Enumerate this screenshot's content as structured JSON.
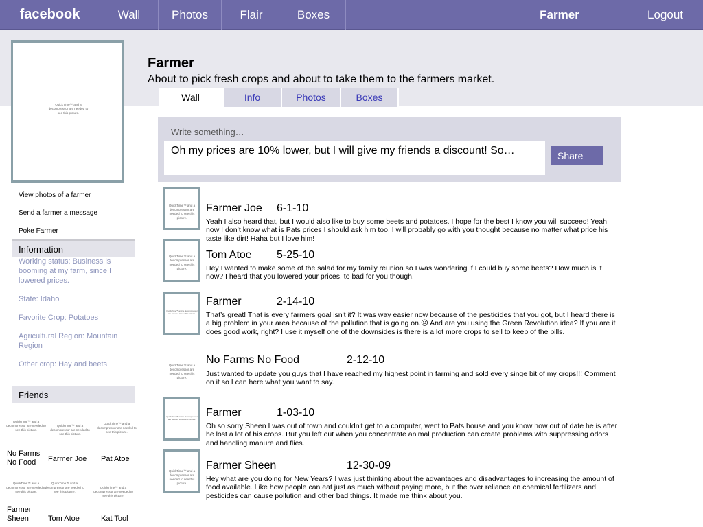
{
  "topnav": {
    "logo": "facebook",
    "links": [
      "Wall",
      "Photos",
      "Flair",
      "Boxes"
    ],
    "user": "Farmer",
    "logout": "Logout"
  },
  "profile": {
    "name": "Farmer",
    "status": "About to pick fresh crops and about to take them to the farmers market.",
    "picture_placeholder": "QuickTime™ and a decompressor are needed to see this picture."
  },
  "tabs": [
    "Wall",
    "Info",
    "Photos",
    "Boxes"
  ],
  "left_links": [
    "View photos of a farmer",
    "Send a farmer a message",
    "Poke Farmer"
  ],
  "information": {
    "header": "Information",
    "items": [
      "Working status:  Business is booming  at my farm, since I lowered prices.",
      "State: Idaho",
      "Favorite Crop: Potatoes",
      "Agricultural Region: Mountain Region",
      "Other crop: Hay and beets"
    ]
  },
  "friends": {
    "header": "Friends",
    "list": [
      {
        "name": "No Farms No Food",
        "thumb": "QuickTime™ and a decompressor are needed to see this picture."
      },
      {
        "name": "Farmer Joe",
        "thumb": "QuickTime™ and a decompressor are needed to see this picture."
      },
      {
        "name": "Pat Atoe",
        "thumb": "QuickTime™ and a decompressor are needed to see this picture."
      },
      {
        "name": "Farmer Sheen",
        "thumb": "QuickTime™ and a decompressor are needed to see this picture."
      },
      {
        "name": "Tom Atoe",
        "thumb": "QuickTime™ and a decompressor are needed to see this picture."
      },
      {
        "name": "Kat Tool",
        "thumb": "QuickTime™ and a decompressor are needed to see this picture."
      }
    ]
  },
  "composer": {
    "label": "Write something…",
    "value": "Oh my prices are 10% lower, but I will give my friends a discount! So…",
    "share": "Share"
  },
  "posts": [
    {
      "author": "Farmer Joe",
      "date": "6-1-10",
      "thumb": "QuickTime™ and a decompressor are needed to see this picture.",
      "text": "Yeah I also heard that, but I would also like to buy some beets and potatoes. I hope for the best I know you will succeed! Yeah now I don’t know what is Pats prices I should ask him too, I will probably go with you thought because no matter what price his taste like dirt! Haha but I love him!"
    },
    {
      "author": "Tom Atoe",
      "date": "5-25-10",
      "thumb": "QuickTime™ and a decompressor are needed to see this picture.",
      "text": "Hey I wanted to make some of the salad for my family reunion so I was wondering if I could buy some beets? How much is it now? I heard that you lowered your prices, to bad for you though."
    },
    {
      "author": "Farmer",
      "date": "2-14-10",
      "thumb": "QuickTime™ and a decompressor are needed to see this picture.",
      "text": "That’s great! That is every farmers goal isn't it? It was way easier now because of the pesticides that you got, but I heard there is a big problem in your area because of the pollution that is going on.☹ And are you using the Green Revolution idea? If you are it does good work, right? I use it myself  one of the downsides is there is a lot more crops to sell to keep of the bills."
    },
    {
      "author": "No Farms No Food",
      "date": "2-12-10",
      "thumb": "QuickTime™ and a decompressor are needed to see this picture.",
      "text": "Just wanted to update you guys that I have reached my highest point in farming and sold every singe bit of my crops!!! Comment on it so I can here what you want to say."
    },
    {
      "author": "Farmer",
      "date": "1-03-10",
      "thumb": "QuickTime™ and a decompressor are needed to see this picture.",
      "text": "Oh so sorry Sheen I was out of town and couldn't get to a computer, went to Pats house and you know how out of date he is after he lost a lot of his crops. But  you left out when you concentrate animal production can create problems with suppressing odors and handling manure and flies."
    },
    {
      "author": "Farmer Sheen",
      "date": "12-30-09",
      "thumb": "QuickTime™ and a decompressor are needed to see this picture.",
      "text": "Hey what are you doing for New Years? I was just thinking about  the advantages and disadvantages to increasing the amount of food available. Like how people can eat just as much without paying more, but the over reliance on chemical fertilizers and pesticides can cause pollution and other bad things. It made me think about you."
    }
  ]
}
